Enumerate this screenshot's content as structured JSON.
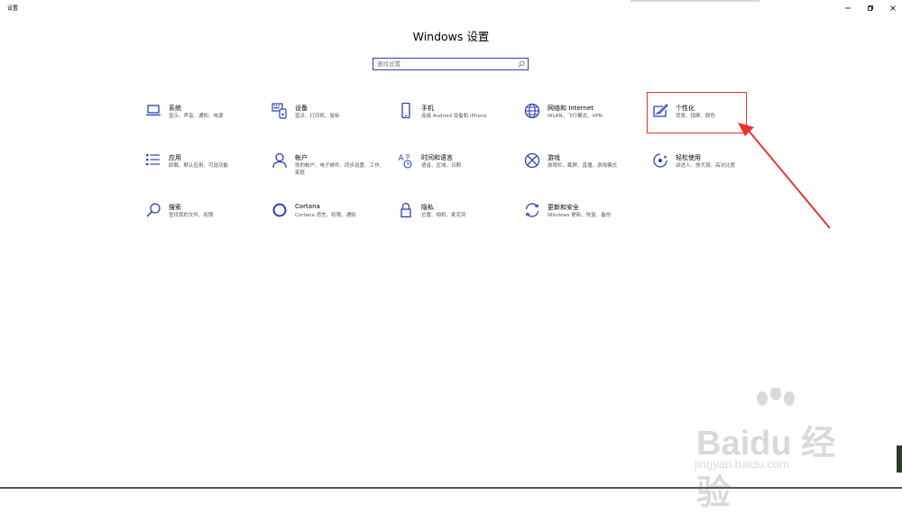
{
  "window": {
    "title": "设置",
    "main_title": "Windows 设置",
    "controls": {
      "minimize": "–",
      "maximize": "⧉",
      "close": "✕"
    }
  },
  "search": {
    "placeholder": "查找设置"
  },
  "tiles": [
    {
      "name": "系统",
      "desc": "显示、声音、通知、电源",
      "icon": "laptop-icon"
    },
    {
      "name": "设备",
      "desc": "蓝牙、打印机、鼠标",
      "icon": "devices-icon"
    },
    {
      "name": "手机",
      "desc": "连接 Android 设备和 iPhone",
      "icon": "phone-icon"
    },
    {
      "name": "网络和 Internet",
      "desc": "WLAN、飞行模式、VPN",
      "icon": "globe-icon"
    },
    {
      "name": "个性化",
      "desc": "背景、锁屏、颜色",
      "icon": "personalization-icon"
    },
    {
      "name": "应用",
      "desc": "卸载、默认应用、可选功能",
      "icon": "apps-list-icon"
    },
    {
      "name": "帐户",
      "desc": "你的帐户、电子邮件、同步设置、工作、家庭",
      "icon": "person-icon"
    },
    {
      "name": "时间和语言",
      "desc": "语音、区域、日期",
      "icon": "time-language-icon"
    },
    {
      "name": "游戏",
      "desc": "游戏栏、截屏、直播、游戏模式",
      "icon": "xbox-icon"
    },
    {
      "name": "轻松使用",
      "desc": "讲述人、放大镜、高对比度",
      "icon": "ease-of-access-icon"
    },
    {
      "name": "搜索",
      "desc": "查找我的文件、权限",
      "icon": "search-icon"
    },
    {
      "name": "Cortana",
      "desc": "Cortana 语言、权限、通知",
      "icon": "cortana-icon"
    },
    {
      "name": "隐私",
      "desc": "位置、相机、麦克风",
      "icon": "lock-icon"
    },
    {
      "name": "更新和安全",
      "desc": "Windows 更新、恢复、备份",
      "icon": "update-icon"
    }
  ],
  "colors": {
    "accent": "#2b3fb8",
    "annotation": "#e8332c",
    "text": "#000000",
    "subtext": "#555555"
  },
  "watermark": {
    "brand": "Baidu 经验",
    "url": "jingyan.baidu.com"
  }
}
